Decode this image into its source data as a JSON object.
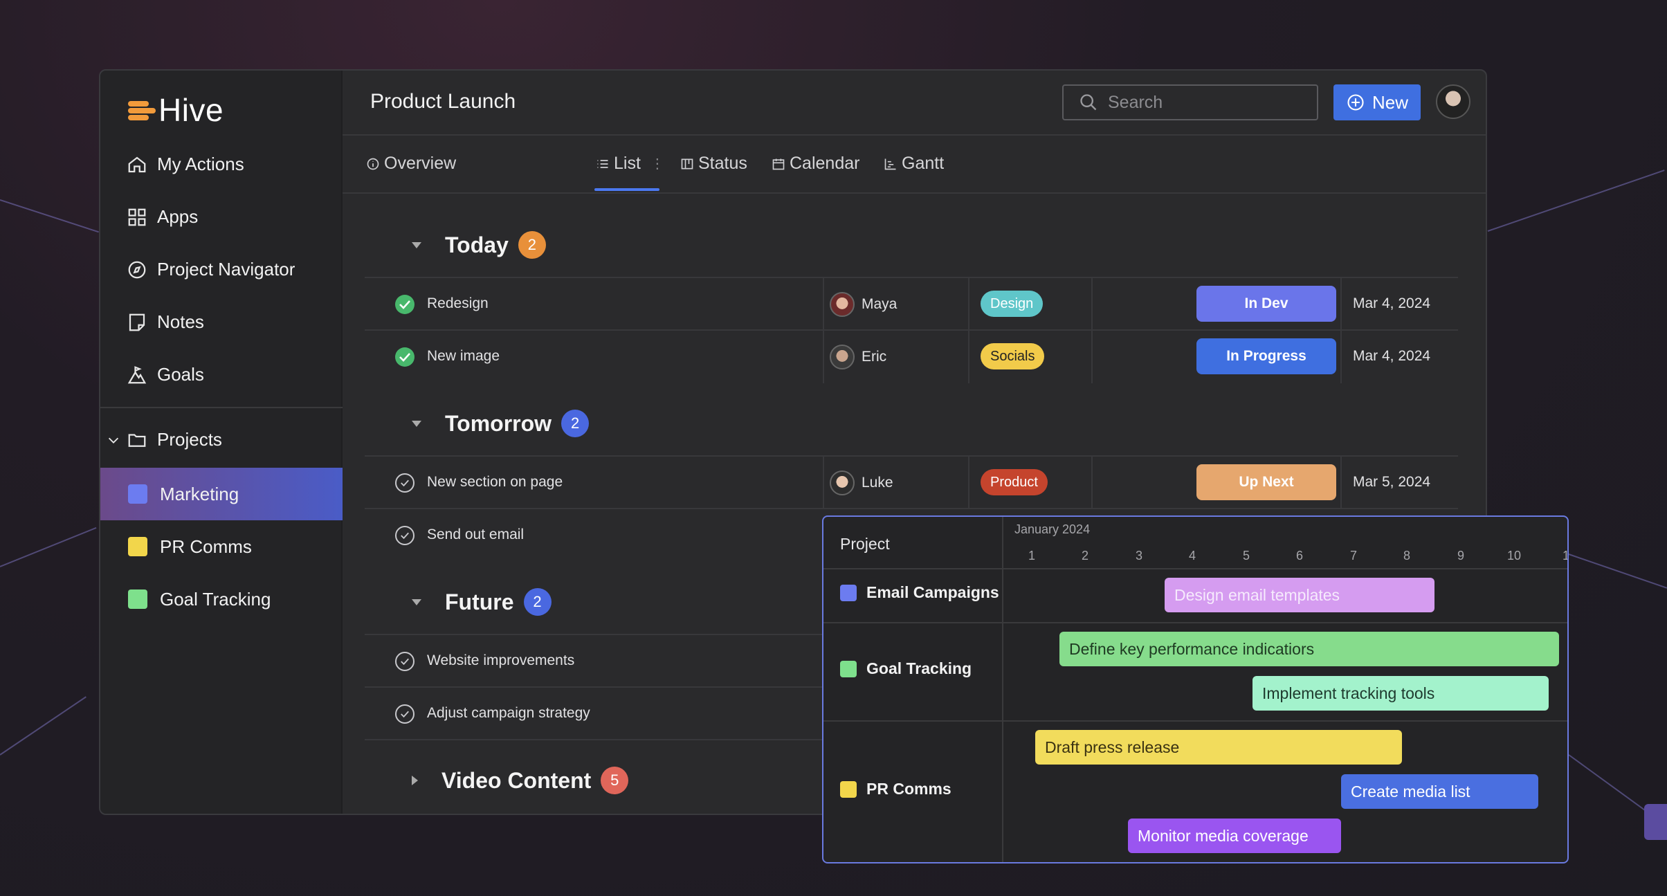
{
  "app": {
    "name": "Hive"
  },
  "sidebar": {
    "nav": [
      {
        "label": "My Actions",
        "icon": "home-icon"
      },
      {
        "label": "Apps",
        "icon": "apps-grid-icon"
      },
      {
        "label": "Project Navigator",
        "icon": "compass-icon"
      },
      {
        "label": "Notes",
        "icon": "note-icon"
      },
      {
        "label": "Goals",
        "icon": "goals-icon"
      }
    ],
    "projects_label": "Projects",
    "projects": [
      {
        "label": "Marketing",
        "color": "#6c7cf0",
        "active": true
      },
      {
        "label": "PR Comms",
        "color": "#f2d64b",
        "active": false
      },
      {
        "label": "Goal Tracking",
        "color": "#7ee08c",
        "active": false
      }
    ]
  },
  "header": {
    "title": "Product Launch",
    "search_placeholder": "Search",
    "new_label": "New"
  },
  "tabs": [
    {
      "label": "Overview",
      "icon": "info-icon"
    },
    {
      "label": "List",
      "icon": "list-icon",
      "active": true
    },
    {
      "label": "Status",
      "icon": "status-board-icon"
    },
    {
      "label": "Calendar",
      "icon": "calendar-icon"
    },
    {
      "label": "Gantt",
      "icon": "gantt-icon"
    }
  ],
  "groups": {
    "today": {
      "title": "Today",
      "count": "2",
      "count_color": "#e8903a"
    },
    "tomorrow": {
      "title": "Tomorrow",
      "count": "2",
      "count_color": "#4a68e0"
    },
    "future": {
      "title": "Future",
      "count": "2",
      "count_color": "#4a68e0"
    },
    "video": {
      "title": "Video Content",
      "count": "5",
      "count_color": "#e0665a"
    }
  },
  "tasks": {
    "redesign": {
      "title": "Redesign",
      "assignee": "Maya",
      "tag": "Design",
      "status": "In Dev",
      "date": "Mar 4, 2024"
    },
    "new_image": {
      "title": "New image",
      "assignee": "Eric",
      "tag": "Socials",
      "status": "In Progress",
      "date": "Mar 4, 2024"
    },
    "new_section": {
      "title": "New section on page",
      "assignee": "Luke",
      "tag": "Product",
      "status": "Up Next",
      "date": "Mar 5, 2024"
    },
    "send_email": {
      "title": "Send out email"
    },
    "website": {
      "title": "Website improvements"
    },
    "adjust": {
      "title": "Adjust campaign strategy"
    }
  },
  "gantt": {
    "project_header": "Project",
    "month": "January 2024",
    "days": [
      "1",
      "2",
      "3",
      "4",
      "5",
      "6",
      "7",
      "8",
      "9",
      "10",
      "1"
    ],
    "projects": {
      "email": {
        "label": "Email Campaigns",
        "color": "#6c7cf0"
      },
      "goal": {
        "label": "Goal Tracking",
        "color": "#7ee08c"
      },
      "pr": {
        "label": "PR Comms",
        "color": "#f2d64b"
      }
    },
    "bars": {
      "design_email": "Design email templates",
      "define_kpi": "Define key performance indicatiors",
      "implement": "Implement tracking tools",
      "draft_press": "Draft press release",
      "media_list": "Create media list",
      "monitor": "Monitor media coverage"
    }
  }
}
